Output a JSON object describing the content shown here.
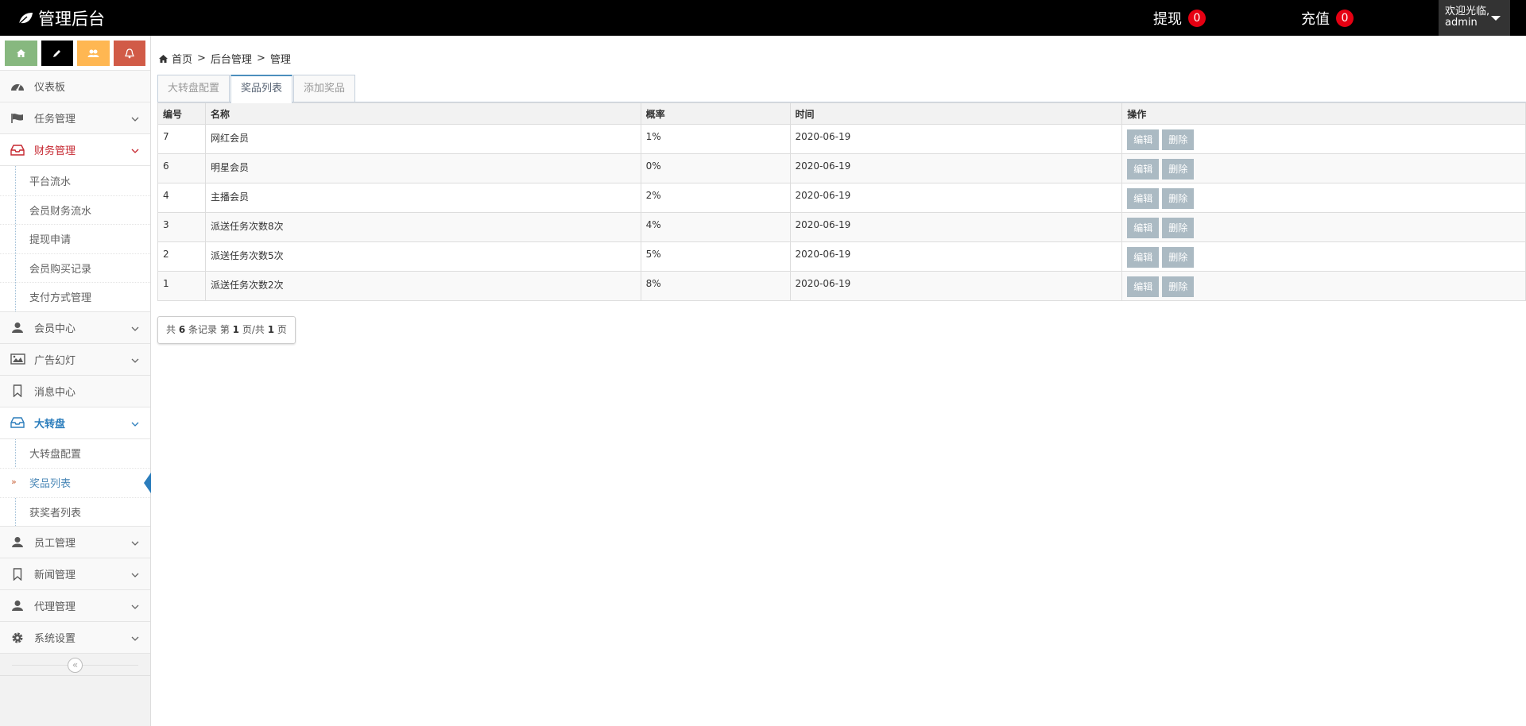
{
  "header": {
    "brand": "管理后台",
    "withdraw_label": "提现",
    "withdraw_count": "0",
    "recharge_label": "充值",
    "recharge_count": "0",
    "welcome": "欢迎光临,",
    "username": "admin"
  },
  "sidebar": {
    "dashboard": "仪表板",
    "task": "任务管理",
    "finance": "财务管理",
    "finance_items": [
      "平台流水",
      "会员财务流水",
      "提现申请",
      "会员购买记录",
      "支付方式管理"
    ],
    "member": "会员中心",
    "ads": "广告幻灯",
    "message": "消息中心",
    "wheel": "大转盘",
    "wheel_items": [
      "大转盘配置",
      "奖品列表",
      "获奖者列表"
    ],
    "staff": "员工管理",
    "news": "新闻管理",
    "agent": "代理管理",
    "settings": "系统设置"
  },
  "breadcrumb": [
    "首页",
    ">",
    "后台管理",
    ">",
    "管理"
  ],
  "tabs": [
    "大转盘配置",
    "奖品列表",
    "添加奖品"
  ],
  "table": {
    "headers": [
      "编号",
      "名称",
      "概率",
      "时间",
      "操作"
    ],
    "rows": [
      {
        "id": "7",
        "name": "网红会员",
        "rate": "1%",
        "time": "2020-06-19"
      },
      {
        "id": "6",
        "name": "明星会员",
        "rate": "0%",
        "time": "2020-06-19"
      },
      {
        "id": "4",
        "name": "主播会员",
        "rate": "2%",
        "time": "2020-06-19"
      },
      {
        "id": "3",
        "name": "派送任务次数8次",
        "rate": "4%",
        "time": "2020-06-19"
      },
      {
        "id": "2",
        "name": "派送任务次数5次",
        "rate": "5%",
        "time": "2020-06-19"
      },
      {
        "id": "1",
        "name": "派送任务次数2次",
        "rate": "8%",
        "time": "2020-06-19"
      }
    ],
    "edit_label": "编辑",
    "delete_label": "删除"
  },
  "pager": {
    "p1": "共 ",
    "total": "6",
    "p2": " 条记录 第 ",
    "page": "1",
    "p3": " 页/共 ",
    "pages": "1",
    "p4": " 页"
  },
  "colors": {
    "navbar": "#000000",
    "badge": "#e60012",
    "finance_active": "#c6262f",
    "wheel_active": "#2b7dbc",
    "shortcut_green": "#87b87f",
    "shortcut_black": "#000000",
    "shortcut_yellow": "#ffb752",
    "shortcut_red": "#d15b47",
    "action_button": "#abbac3"
  }
}
